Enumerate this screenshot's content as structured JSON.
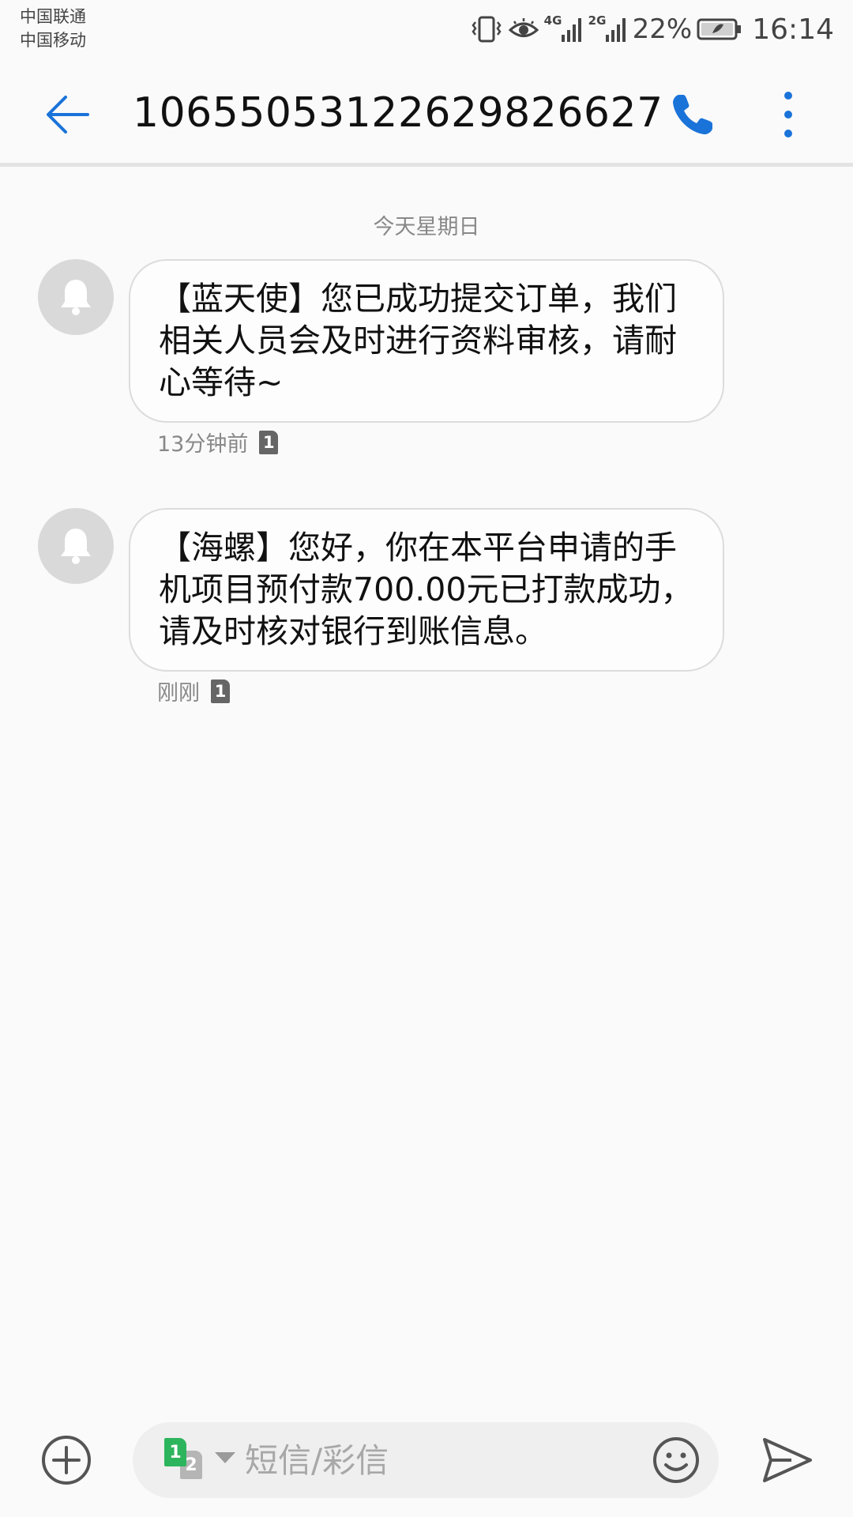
{
  "status_bar": {
    "carrier_1": "中国联通",
    "carrier_2": "中国移动",
    "network_1": "4G",
    "network_2": "2G",
    "battery_percent": "22%",
    "time": "16:14",
    "icons": [
      "vibrate-icon",
      "eye-comfort-icon",
      "signal-4g-icon",
      "signal-2g-icon",
      "battery-icon"
    ]
  },
  "app_bar": {
    "title": "10655053122629826627",
    "icons": [
      "back-arrow-icon",
      "phone-icon",
      "more-vert-icon"
    ],
    "accent_color": "#1a73d9"
  },
  "conversation": {
    "date_header": "今天星期日",
    "messages": [
      {
        "text": "【蓝天使】您已成功提交订单，我们相关人员会及时进行资料审核，请耐心等待~",
        "time": "13分钟前",
        "sim": "1"
      },
      {
        "text": "【海螺】您好，你在本平台申请的手机项目预付款700.00元已打款成功，请及时核对银行到账信息。",
        "time": "刚刚",
        "sim": "1"
      }
    ]
  },
  "composer": {
    "placeholder": "短信/彩信",
    "value": "",
    "sim_primary": "1",
    "sim_secondary": "2",
    "sim_primary_color": "#2db55d",
    "icons": [
      "add-circle-icon",
      "sim-switch-icon",
      "emoji-icon",
      "send-icon"
    ]
  }
}
